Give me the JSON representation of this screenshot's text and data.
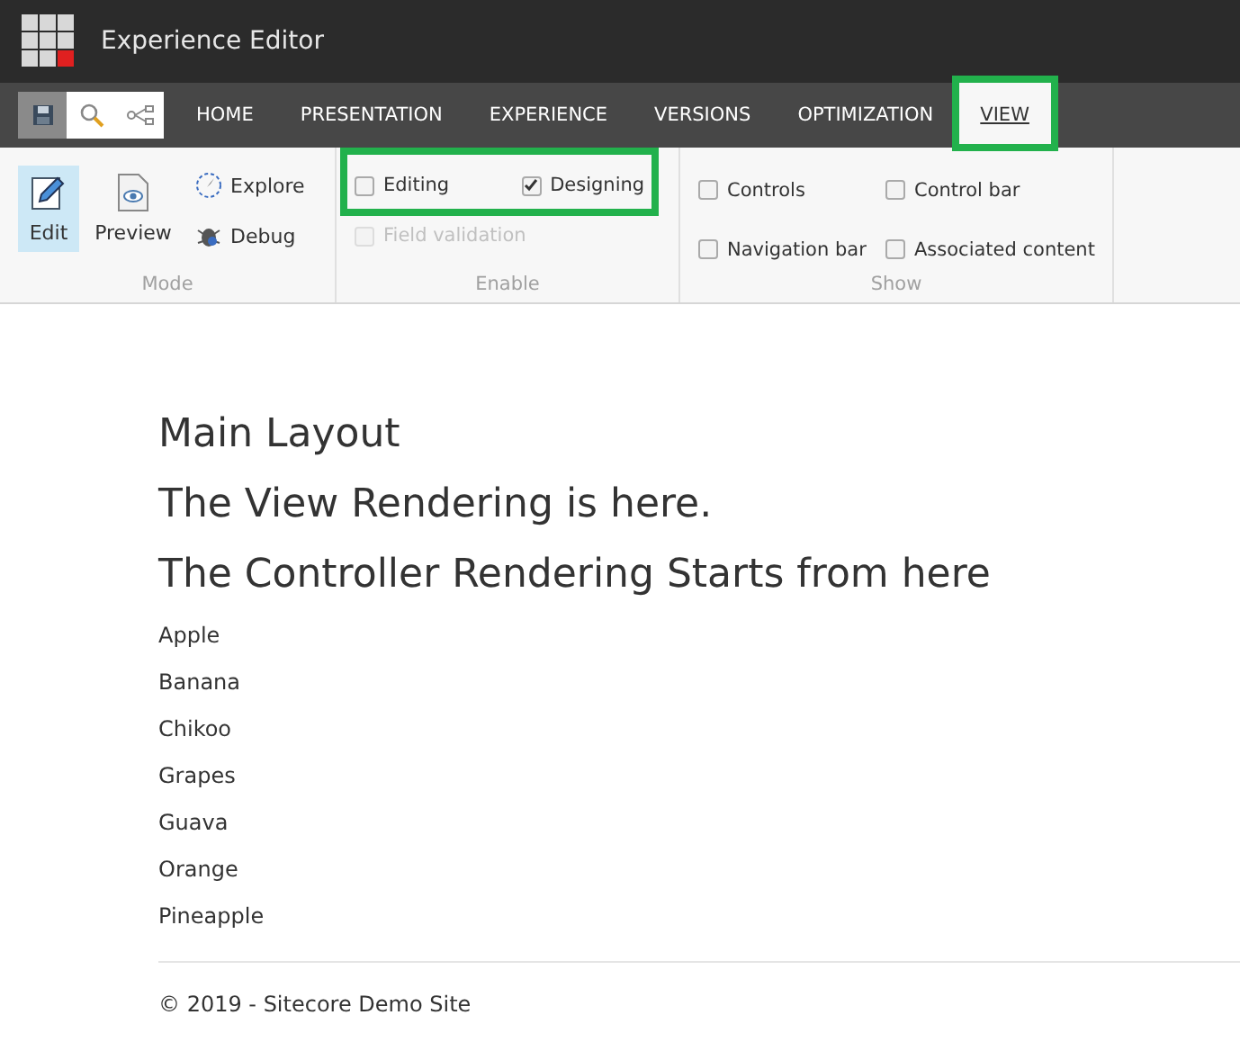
{
  "app_bar": {
    "title": "Experience Editor"
  },
  "quick_tools": [
    {
      "kind": "save",
      "selected": true
    },
    {
      "kind": "search",
      "selected": false
    },
    {
      "kind": "share",
      "selected": false
    }
  ],
  "tabs": [
    {
      "label": "HOME",
      "selected": false,
      "highlighted": false
    },
    {
      "label": "PRESENTATION",
      "selected": false,
      "highlighted": false
    },
    {
      "label": "EXPERIENCE",
      "selected": false,
      "highlighted": false
    },
    {
      "label": "VERSIONS",
      "selected": false,
      "highlighted": false
    },
    {
      "label": "OPTIMIZATION",
      "selected": false,
      "highlighted": false
    },
    {
      "label": "VIEW",
      "selected": true,
      "highlighted": true
    }
  ],
  "ribbon": {
    "mode": {
      "label": "Mode",
      "large_buttons": [
        {
          "label": "Edit",
          "kind": "edit",
          "selected": true
        },
        {
          "label": "Preview",
          "kind": "preview",
          "selected": false
        }
      ],
      "small_buttons": [
        {
          "label": "Explore",
          "kind": "explore"
        },
        {
          "label": "Debug",
          "kind": "debug"
        }
      ]
    },
    "enable": {
      "label": "Enable",
      "rows": [
        {
          "highlighted": true,
          "items": [
            {
              "label": "Editing",
              "checked": false,
              "disabled": false
            },
            {
              "label": "Designing",
              "checked": true,
              "disabled": false
            }
          ]
        },
        {
          "highlighted": false,
          "items": [
            {
              "label": "Field validation",
              "checked": false,
              "disabled": true
            }
          ]
        }
      ]
    },
    "show": {
      "label": "Show",
      "items": [
        {
          "label": "Controls",
          "checked": false
        },
        {
          "label": "Control bar",
          "checked": false
        },
        {
          "label": "Navigation bar",
          "checked": false
        },
        {
          "label": "Associated content",
          "checked": false
        }
      ]
    }
  },
  "page": {
    "headings": [
      "Main Layout",
      "The View Rendering is here.",
      "The Controller Rendering Starts from here"
    ],
    "list": [
      "Apple",
      "Banana",
      "Chikoo",
      "Grapes",
      "Guava",
      "Orange",
      "Pineapple"
    ],
    "footer": "© 2019 - Sitecore Demo Site"
  }
}
